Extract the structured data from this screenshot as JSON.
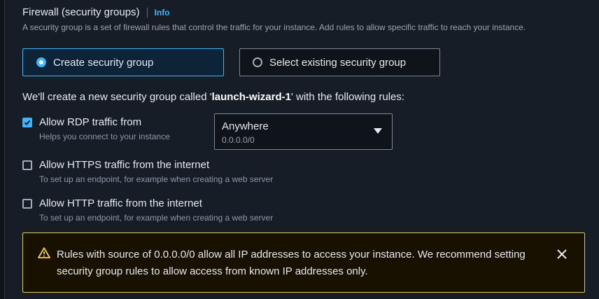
{
  "section": {
    "title": "Firewall (security groups)",
    "info_link": "Info",
    "description": "A security group is a set of firewall rules that control the traffic for your instance. Add rules to allow specific traffic to reach your instance."
  },
  "options": [
    {
      "label": "Create security group",
      "selected": true
    },
    {
      "label": "Select existing security group",
      "selected": false
    }
  ],
  "intro": {
    "prefix": "We'll create a new security group called '",
    "group_name": "launch-wizard-1",
    "suffix": "' with the following rules:"
  },
  "rules": [
    {
      "label": "Allow RDP traffic from",
      "help": "Helps you connect to your instance",
      "checked": true
    },
    {
      "label": "Allow HTTPS traffic from the internet",
      "help": "To set up an endpoint, for example when creating a web server",
      "checked": false
    },
    {
      "label": "Allow HTTP traffic from the internet",
      "help": "To set up an endpoint, for example when creating a web server",
      "checked": false
    }
  ],
  "rdp_source": {
    "value": "Anywhere",
    "sub": "0.0.0.0/0"
  },
  "warning": {
    "text": "Rules with source of 0.0.0.0/0 allow all IP addresses to access your instance. We recommend setting security group rules to allow access from known IP addresses only."
  },
  "icons": {
    "warning": "warning-icon",
    "close": "close-icon",
    "caret": "caret-down-icon",
    "check": "checkmark-icon"
  },
  "colors": {
    "accent": "#42b4ff",
    "warning_border": "#e0ca57",
    "background": "#161d26"
  }
}
